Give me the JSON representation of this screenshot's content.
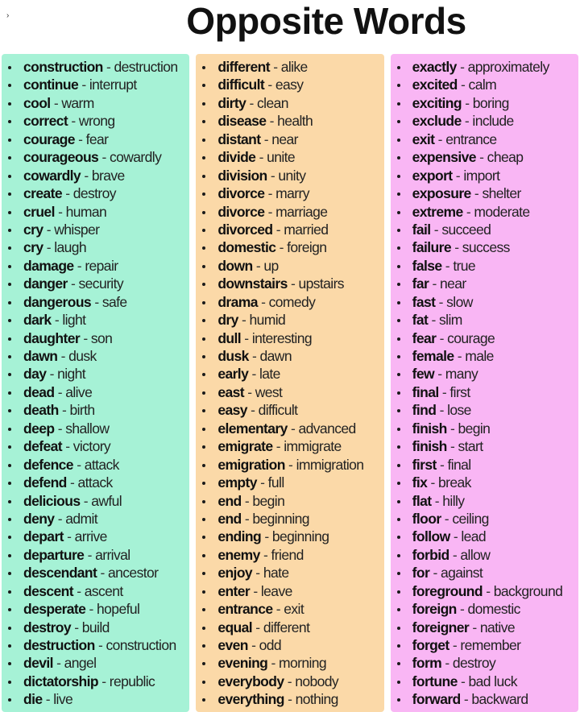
{
  "title": "Opposite Words",
  "colors": {
    "column_1": "#a6f2d6",
    "column_2": "#fbd9a8",
    "column_3": "#f9b6f4"
  },
  "columns": [
    {
      "pairs": [
        {
          "word": "construction",
          "opposite": "destruction"
        },
        {
          "word": "continue",
          "opposite": "interrupt"
        },
        {
          "word": "cool",
          "opposite": "warm"
        },
        {
          "word": "correct",
          "opposite": "wrong"
        },
        {
          "word": "courage",
          "opposite": "fear"
        },
        {
          "word": "courageous",
          "opposite": "cowardly"
        },
        {
          "word": "cowardly",
          "opposite": "brave"
        },
        {
          "word": "create",
          "opposite": "destroy"
        },
        {
          "word": "cruel",
          "opposite": "human"
        },
        {
          "word": "cry",
          "opposite": "whisper"
        },
        {
          "word": "cry",
          "opposite": "laugh"
        },
        {
          "word": "damage",
          "opposite": "repair"
        },
        {
          "word": "danger",
          "opposite": "security"
        },
        {
          "word": "dangerous",
          "opposite": "safe"
        },
        {
          "word": "dark",
          "opposite": "light"
        },
        {
          "word": "daughter",
          "opposite": "son"
        },
        {
          "word": "dawn",
          "opposite": "dusk"
        },
        {
          "word": "day",
          "opposite": "night"
        },
        {
          "word": "dead",
          "opposite": "alive"
        },
        {
          "word": "death",
          "opposite": "birth"
        },
        {
          "word": "deep",
          "opposite": "shallow"
        },
        {
          "word": "defeat",
          "opposite": "victory"
        },
        {
          "word": "defence",
          "opposite": "attack"
        },
        {
          "word": "defend",
          "opposite": "attack"
        },
        {
          "word": "delicious",
          "opposite": "awful"
        },
        {
          "word": "deny",
          "opposite": "admit"
        },
        {
          "word": "depart",
          "opposite": "arrive"
        },
        {
          "word": "departure",
          "opposite": "arrival"
        },
        {
          "word": "descendant",
          "opposite": "ancestor"
        },
        {
          "word": "descent",
          "opposite": "ascent"
        },
        {
          "word": "desperate",
          "opposite": "hopeful"
        },
        {
          "word": "destroy",
          "opposite": "build"
        },
        {
          "word": "destruction",
          "opposite": "construction"
        },
        {
          "word": "devil",
          "opposite": "angel"
        },
        {
          "word": "dictatorship",
          "opposite": "republic"
        },
        {
          "word": "die",
          "opposite": "live"
        }
      ]
    },
    {
      "pairs": [
        {
          "word": "different",
          "opposite": "alike"
        },
        {
          "word": "difficult",
          "opposite": "easy"
        },
        {
          "word": "dirty",
          "opposite": "clean"
        },
        {
          "word": "disease",
          "opposite": "health"
        },
        {
          "word": "distant",
          "opposite": "near"
        },
        {
          "word": "divide",
          "opposite": "unite"
        },
        {
          "word": "division",
          "opposite": "unity"
        },
        {
          "word": "divorce",
          "opposite": "marry"
        },
        {
          "word": "divorce",
          "opposite": "marriage"
        },
        {
          "word": "divorced",
          "opposite": "married"
        },
        {
          "word": "domestic",
          "opposite": "foreign"
        },
        {
          "word": "down",
          "opposite": "up"
        },
        {
          "word": "downstairs",
          "opposite": "upstairs"
        },
        {
          "word": "drama",
          "opposite": "comedy"
        },
        {
          "word": "dry",
          "opposite": "humid"
        },
        {
          "word": "dull",
          "opposite": "interesting"
        },
        {
          "word": "dusk",
          "opposite": "dawn"
        },
        {
          "word": "early",
          "opposite": "late"
        },
        {
          "word": "east",
          "opposite": "west"
        },
        {
          "word": "easy",
          "opposite": "difficult"
        },
        {
          "word": "elementary",
          "opposite": "advanced"
        },
        {
          "word": "emigrate",
          "opposite": "immigrate"
        },
        {
          "word": "emigration",
          "opposite": "immigration"
        },
        {
          "word": "empty",
          "opposite": "full"
        },
        {
          "word": "end",
          "opposite": "begin"
        },
        {
          "word": "end",
          "opposite": "beginning"
        },
        {
          "word": "ending",
          "opposite": "beginning"
        },
        {
          "word": "enemy",
          "opposite": "friend"
        },
        {
          "word": "enjoy",
          "opposite": "hate"
        },
        {
          "word": "enter",
          "opposite": "leave"
        },
        {
          "word": "entrance",
          "opposite": "exit"
        },
        {
          "word": "equal",
          "opposite": "different"
        },
        {
          "word": "even",
          "opposite": "odd"
        },
        {
          "word": "evening",
          "opposite": "morning"
        },
        {
          "word": "everybody",
          "opposite": "nobody"
        },
        {
          "word": "everything",
          "opposite": "nothing"
        }
      ]
    },
    {
      "pairs": [
        {
          "word": "exactly",
          "opposite": "approximately"
        },
        {
          "word": "excited",
          "opposite": "calm"
        },
        {
          "word": "exciting",
          "opposite": "boring"
        },
        {
          "word": "exclude",
          "opposite": "include"
        },
        {
          "word": "exit",
          "opposite": "entrance"
        },
        {
          "word": "expensive",
          "opposite": "cheap"
        },
        {
          "word": "export",
          "opposite": "import"
        },
        {
          "word": "exposure",
          "opposite": "shelter"
        },
        {
          "word": "extreme",
          "opposite": "moderate"
        },
        {
          "word": "fail",
          "opposite": "succeed"
        },
        {
          "word": "failure",
          "opposite": "success"
        },
        {
          "word": "false",
          "opposite": "true"
        },
        {
          "word": "far",
          "opposite": "near"
        },
        {
          "word": "fast",
          "opposite": "slow"
        },
        {
          "word": "fat",
          "opposite": "slim"
        },
        {
          "word": "fear",
          "opposite": "courage"
        },
        {
          "word": "female",
          "opposite": "male"
        },
        {
          "word": "few",
          "opposite": "many"
        },
        {
          "word": "final",
          "opposite": "first"
        },
        {
          "word": "find",
          "opposite": "lose"
        },
        {
          "word": "finish",
          "opposite": "begin"
        },
        {
          "word": "finish",
          "opposite": "start"
        },
        {
          "word": "first",
          "opposite": "final"
        },
        {
          "word": "fix",
          "opposite": "break"
        },
        {
          "word": "flat",
          "opposite": "hilly"
        },
        {
          "word": "floor",
          "opposite": "ceiling"
        },
        {
          "word": "follow",
          "opposite": "lead"
        },
        {
          "word": "forbid",
          "opposite": "allow"
        },
        {
          "word": "for",
          "opposite": "against"
        },
        {
          "word": "foreground",
          "opposite": "background"
        },
        {
          "word": "foreign",
          "opposite": "domestic"
        },
        {
          "word": "foreigner",
          "opposite": "native"
        },
        {
          "word": "forget",
          "opposite": "remember"
        },
        {
          "word": "form",
          "opposite": "destroy"
        },
        {
          "word": "fortune",
          "opposite": "bad luck"
        },
        {
          "word": "forward",
          "opposite": "backward"
        }
      ]
    }
  ]
}
